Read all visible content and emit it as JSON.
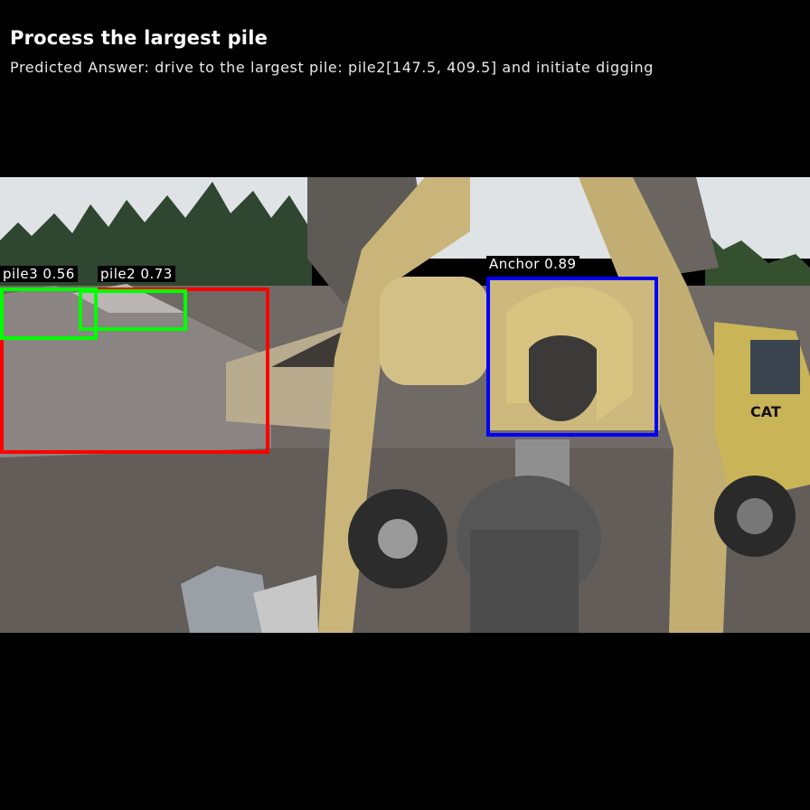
{
  "header": {
    "title": "Process the largest pile",
    "predicted_answer": "Predicted Answer: drive to the largest pile: pile2[147.5, 409.5] and initiate digging"
  },
  "detections": [
    {
      "label": "pile3 0.56",
      "color": "#00ff00"
    },
    {
      "label": "pile2 0.73",
      "color": "#00ff00"
    },
    {
      "label": "",
      "color": "#ff0000"
    },
    {
      "label": "Anchor 0.89",
      "color": "#0000ff"
    }
  ],
  "scene": {
    "description_colors": {
      "sky": "#dfe3e6",
      "gravel": "#6f6a66",
      "machine": "#c9b57a"
    },
    "cat_logo": "CAT"
  }
}
